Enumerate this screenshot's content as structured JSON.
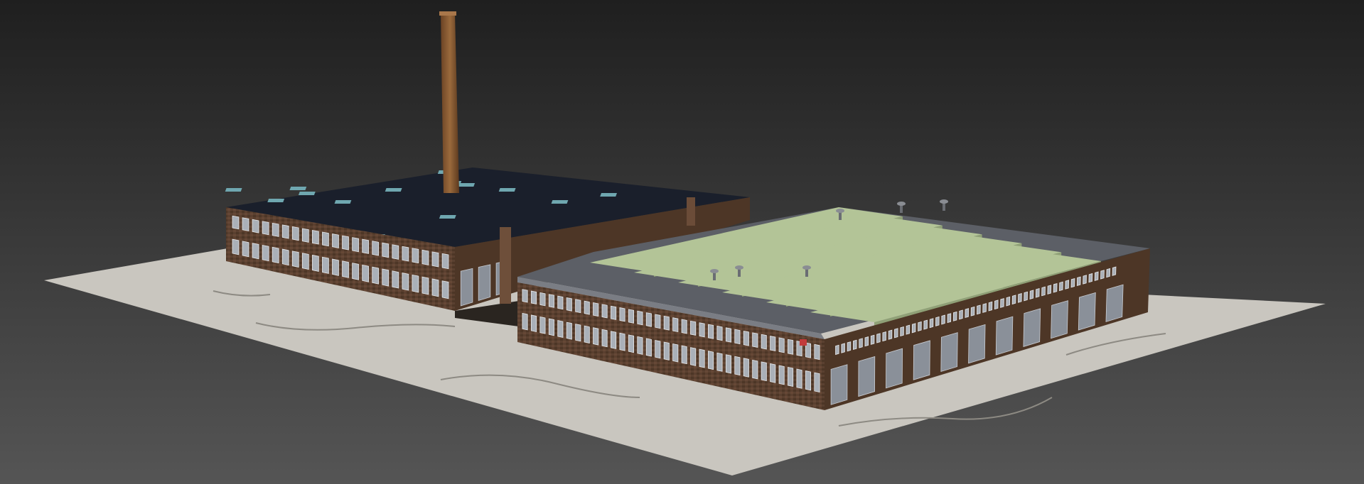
{
  "scene": {
    "subject": "factory-complex",
    "colors": {
      "background_top": "#1f1f1f",
      "background_bottom": "#555555",
      "ground": "#c9c6bf",
      "ground_shadow": "#a7a49d",
      "brick": "#5a4030",
      "brick_dark": "#3f2c20",
      "brick_light": "#765640",
      "window": "#aab0b8",
      "window_frame": "#e6e8ea",
      "dark_roof": "#1a1f2b",
      "skylight": "#6fa7b0",
      "grey_roof": "#5c5f66",
      "grey_roof_light": "#7a7d84",
      "green_roof": "#b3c497",
      "green_roof_dark": "#8fa076",
      "chimney": "#8a5a32",
      "door": "#8a9099"
    }
  }
}
